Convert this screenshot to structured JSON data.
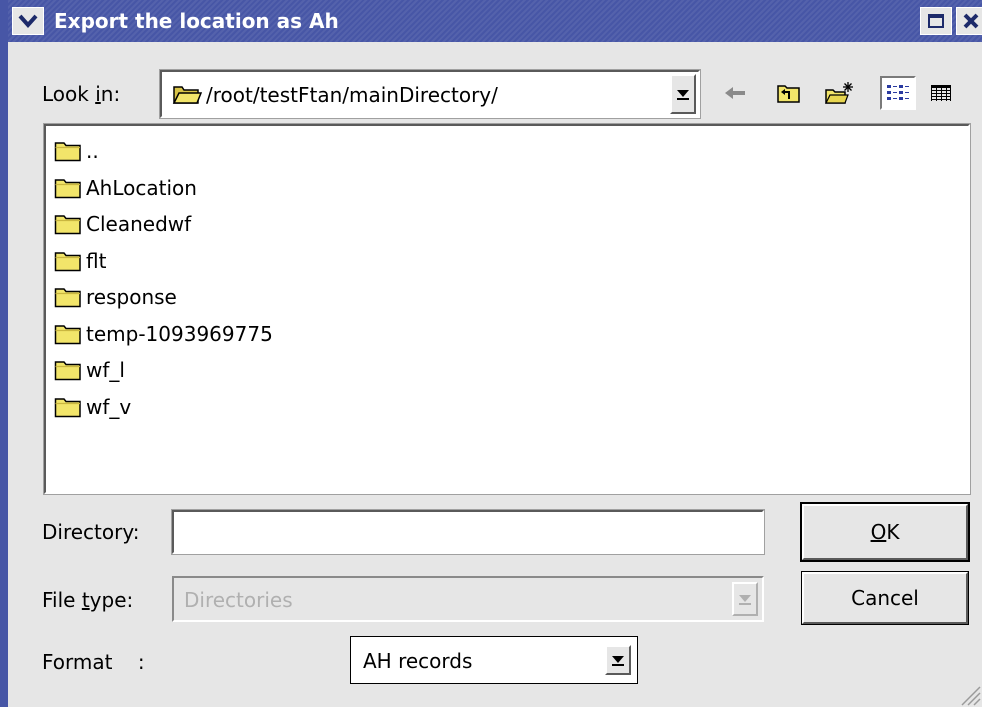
{
  "window": {
    "title": "Export the location as Ah"
  },
  "colors": {
    "titlebar": "#4756a6",
    "background": "#e6e6e6",
    "folder_fill": "#f2e56a",
    "disabled_text": "#b0b0b0"
  },
  "look_in": {
    "label_prefix": "Look ",
    "label_mnemonic": "i",
    "label_suffix": "n:",
    "path": "/root/testFtan/mainDirectory/"
  },
  "toolbar": {
    "icons": [
      "back-arrow-icon",
      "parent-folder-icon",
      "new-folder-icon",
      "list-view-icon",
      "detail-view-icon"
    ]
  },
  "files": [
    {
      "name": ".."
    },
    {
      "name": "AhLocation"
    },
    {
      "name": "Cleanedwf"
    },
    {
      "name": "flt"
    },
    {
      "name": "response"
    },
    {
      "name": "temp-1093969775"
    },
    {
      "name": "wf_l"
    },
    {
      "name": "wf_v"
    }
  ],
  "directory": {
    "label": "Directory:",
    "value": ""
  },
  "file_type": {
    "label_prefix": "File ",
    "label_mnemonic": "t",
    "label_suffix": "ype:",
    "value": "Directories"
  },
  "format": {
    "label": "Format    :",
    "value": "AH records"
  },
  "buttons": {
    "ok_mnemonic": "O",
    "ok_suffix": "K",
    "cancel": "Cancel"
  }
}
